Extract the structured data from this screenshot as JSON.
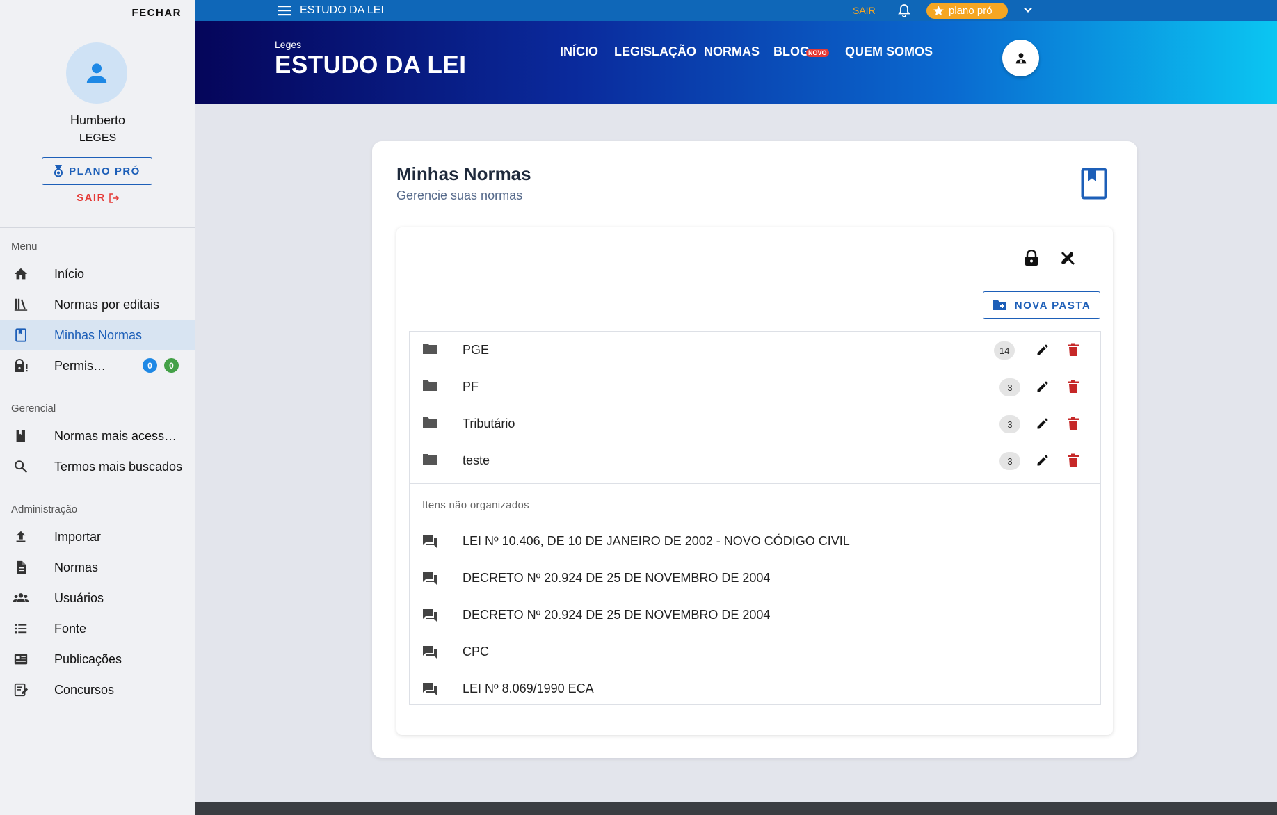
{
  "sidebar": {
    "close_label": "FECHAR",
    "user_name": "Humberto",
    "user_org": "LEGES",
    "plano_label": "PLANO PRÓ",
    "sair_label": "SAIR",
    "sections": {
      "menu": "Menu",
      "gerencial": "Gerencial",
      "admin": "Administração"
    },
    "menu_items": [
      {
        "label": "Início",
        "icon": "home-icon"
      },
      {
        "label": "Normas por editais",
        "icon": "library-icon"
      },
      {
        "label": "Minhas Normas",
        "icon": "bookmark-icon",
        "active": true
      },
      {
        "label": "Permissões",
        "icon": "lock-alert-icon",
        "badges": [
          "0",
          "0"
        ]
      }
    ],
    "gerencial_items": [
      {
        "label": "Normas mais acessadas",
        "icon": "book-icon"
      },
      {
        "label": "Termos mais buscados",
        "icon": "search-icon"
      }
    ],
    "admin_items": [
      {
        "label": "Importar",
        "icon": "upload-icon"
      },
      {
        "label": "Normas",
        "icon": "document-icon"
      },
      {
        "label": "Usuários",
        "icon": "users-icon"
      },
      {
        "label": "Fonte",
        "icon": "list-icon"
      },
      {
        "label": "Publicações",
        "icon": "newspaper-icon"
      },
      {
        "label": "Concursos",
        "icon": "edit-note-icon"
      }
    ]
  },
  "topbar": {
    "title": "ESTUDO DA LEI",
    "sair": "SAIR",
    "plano": "plano pró"
  },
  "header": {
    "brand_sub": "Leges",
    "brand_title": "ESTUDO DA LEI",
    "nav": [
      "INÍCIO",
      "LEGISLAÇÃO",
      "NORMAS",
      "BLOG",
      "QUEM SOMOS"
    ],
    "novo_tag": "NOVO"
  },
  "main": {
    "title": "Minhas Normas",
    "subtitle": "Gerencie suas normas",
    "nova_pasta": "NOVA PASTA",
    "folders": [
      {
        "name": "PGE",
        "count": "14"
      },
      {
        "name": "PF",
        "count": "3"
      },
      {
        "name": "Tributário",
        "count": "3"
      },
      {
        "name": "teste",
        "count": "3"
      }
    ],
    "unorganized_label": "Itens não organizados",
    "items": [
      "LEI Nº 10.406, DE 10 DE JANEIRO DE 2002 - NOVO CÓDIGO CIVIL",
      "DECRETO Nº 20.924 DE 25 DE NOVEMBRO DE 2004",
      "DECRETO Nº 20.924 DE 25 DE NOVEMBRO DE 2004",
      "CPC",
      "LEI Nº 8.069/1990 ECA"
    ]
  },
  "colors": {
    "accent": "#1d5fb8",
    "danger": "#c62828",
    "pro": "#f5a623"
  }
}
